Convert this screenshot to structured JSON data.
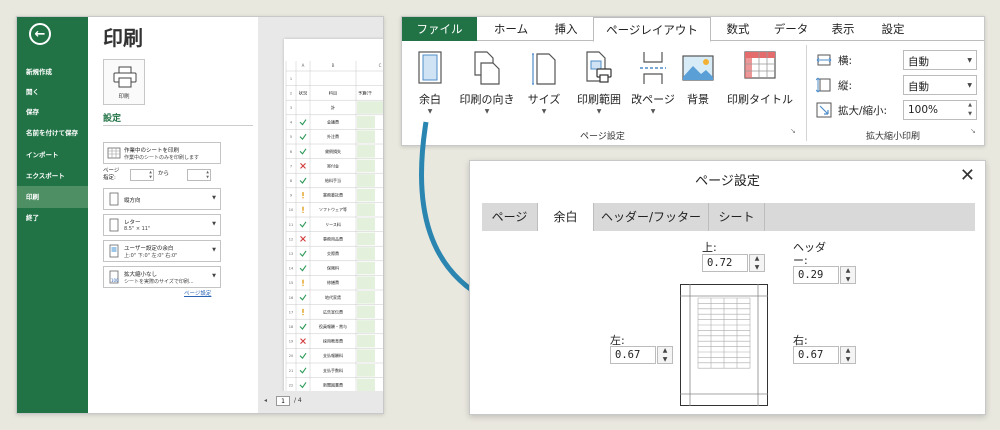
{
  "backstage": {
    "items": [
      "新規作成",
      "開く",
      "保存",
      "名前を付けて保存",
      "インポート",
      "エクスポート",
      "印刷",
      "終了"
    ],
    "active_index": 6
  },
  "print_panel": {
    "title": "印刷",
    "print_button": "印刷",
    "settings_heading": "設定",
    "what_to_print": {
      "line1": "作業中のシートを印刷",
      "line2": "作業中のシートのみを印刷します"
    },
    "pages": {
      "label_line1": "ページ",
      "label_line2": "指定:",
      "to_label": "から",
      "from_value": "",
      "to_value": ""
    },
    "orientation": "縦方向",
    "paper": {
      "line1": "レター",
      "line2": "8.5\" × 11\""
    },
    "margins": {
      "line1": "ユーザー設定の余白",
      "line2": "上:0\"  下:0\"  左:0\"  右:0\""
    },
    "scaling": {
      "line1": "拡大縮小なし",
      "line2": "シートを実際のサイズで印刷..."
    },
    "page_setup_link": "ページ設定"
  },
  "preview": {
    "columns": [
      "A",
      "B",
      "C"
    ],
    "header_row": {
      "status": "状況",
      "item": "科目",
      "budget": "予算(千"
    },
    "total_label": "計",
    "rows": [
      {
        "n": "4",
        "status": "check",
        "item": "会議費"
      },
      {
        "n": "5",
        "status": "check",
        "item": "外注費"
      },
      {
        "n": "6",
        "status": "check",
        "item": "貸倒損失"
      },
      {
        "n": "7",
        "status": "cross",
        "item": "寄付金"
      },
      {
        "n": "8",
        "status": "check",
        "item": "給料手当"
      },
      {
        "n": "9",
        "status": "warn",
        "item": "業務委託費"
      },
      {
        "n": "10",
        "status": "warn",
        "item": "ソフトウェア等"
      },
      {
        "n": "11",
        "status": "check",
        "item": "リース料"
      },
      {
        "n": "12",
        "status": "cross",
        "item": "事務用品費"
      },
      {
        "n": "13",
        "status": "check",
        "item": "交際費"
      },
      {
        "n": "14",
        "status": "check",
        "item": "保険料"
      },
      {
        "n": "15",
        "status": "warn",
        "item": "修繕費"
      },
      {
        "n": "16",
        "status": "check",
        "item": "地代家賃"
      },
      {
        "n": "17",
        "status": "warn",
        "item": "広告宣伝費"
      },
      {
        "n": "18",
        "status": "check",
        "item": "役員報酬・賞与"
      },
      {
        "n": "19",
        "status": "cross",
        "item": "採用教育費"
      },
      {
        "n": "20",
        "status": "check",
        "item": "支払報酬料"
      },
      {
        "n": "21",
        "status": "check",
        "item": "支払手数料"
      },
      {
        "n": "22",
        "status": "check",
        "item": "新聞図書費"
      }
    ],
    "page_current": "1",
    "page_total": "/ 4"
  },
  "ribbon": {
    "tabs": [
      "ファイル",
      "ホーム",
      "挿入",
      "ページレイアウト",
      "数式",
      "データ",
      "表示",
      "設定"
    ],
    "active_tab": 3,
    "page_setup_buttons": [
      "余白",
      "印刷の向き",
      "サイズ",
      "印刷範囲",
      "改ページ",
      "背景",
      "印刷タイトル"
    ],
    "page_setup_group": "ページ設定",
    "scale_group": "拡大縮小印刷",
    "width": {
      "label": "横:",
      "value": "自動"
    },
    "height": {
      "label": "縦:",
      "value": "自動"
    },
    "scale": {
      "label": "拡大/縮小:",
      "value": "100%"
    }
  },
  "dialog": {
    "title": "ページ設定",
    "tabs": [
      "ページ",
      "余白",
      "ヘッダー/フッター",
      "シート"
    ],
    "active_tab": 1,
    "top": {
      "label": "上:",
      "value": "0.72"
    },
    "header": {
      "label_line1": "ヘッダ",
      "label_line2": "ー:",
      "value": "0.29"
    },
    "left": {
      "label": "左:",
      "value": "0.67"
    },
    "right": {
      "label": "右:",
      "value": "0.67"
    }
  },
  "colors": {
    "excel_green": "#217346",
    "active_green": "#4f8f64",
    "callout_arrow": "#2a86b0"
  }
}
